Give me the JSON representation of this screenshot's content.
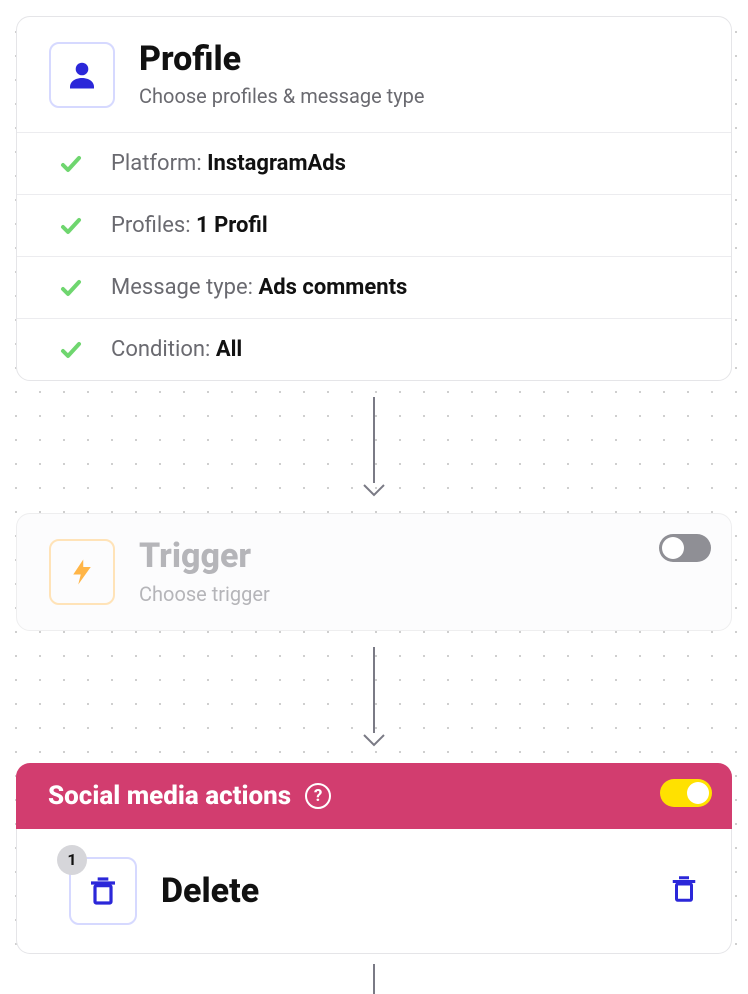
{
  "profile": {
    "title": "Profile",
    "subtitle": "Choose profiles & message type",
    "rows": [
      {
        "label": "Platform: ",
        "value": "InstagramAds"
      },
      {
        "label": "Profiles: ",
        "value": "1 Profil"
      },
      {
        "label": "Message type: ",
        "value": "Ads comments"
      },
      {
        "label": "Condition: ",
        "value": "All"
      }
    ]
  },
  "trigger": {
    "title": "Trigger",
    "subtitle": "Choose trigger"
  },
  "social": {
    "title": "Social media actions",
    "action": {
      "badge": "1",
      "label": "Delete"
    }
  },
  "colors": {
    "accentBlue": "#2b27d9",
    "accentPink": "#d23d6f",
    "checkGreen": "#6fd66f",
    "boltOrange": "#ffb547"
  }
}
